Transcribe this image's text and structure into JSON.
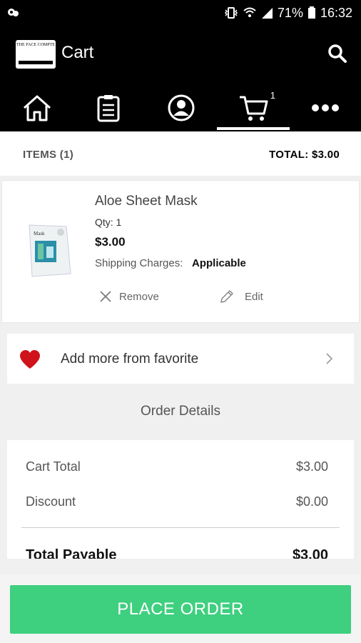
{
  "status_bar": {
    "battery_percent": "71%",
    "time": "16:32"
  },
  "header": {
    "title": "Cart",
    "logo_text": "THE FACE COMPTE"
  },
  "tabs": [
    {
      "name": "home-icon"
    },
    {
      "name": "orders-icon"
    },
    {
      "name": "account-icon"
    },
    {
      "name": "cart-icon",
      "badge": "1",
      "active": true
    },
    {
      "name": "more-icon"
    }
  ],
  "summary": {
    "items_label": "ITEMS (1)",
    "total_label": "TOTAL: $3.00"
  },
  "cart_item": {
    "name": "Aloe Sheet Mask",
    "qty": "Qty: 1",
    "price": "$3.00",
    "shipping_label": "Shipping Charges:",
    "shipping_value": "Applicable",
    "remove_label": "Remove",
    "edit_label": "Edit"
  },
  "favorites": {
    "label": "Add more from favorite"
  },
  "order_details": {
    "heading": "Order Details",
    "rows": [
      {
        "label": "Cart Total",
        "value": "$3.00"
      },
      {
        "label": "Discount",
        "value": "$0.00"
      }
    ],
    "total_label": "Total Payable",
    "total_value": "$3.00"
  },
  "footer": {
    "place_order_label": "PLACE ORDER"
  },
  "colors": {
    "accent_green": "#3ecf7f",
    "header_bg": "#000000",
    "heart_red": "#d0121b"
  }
}
